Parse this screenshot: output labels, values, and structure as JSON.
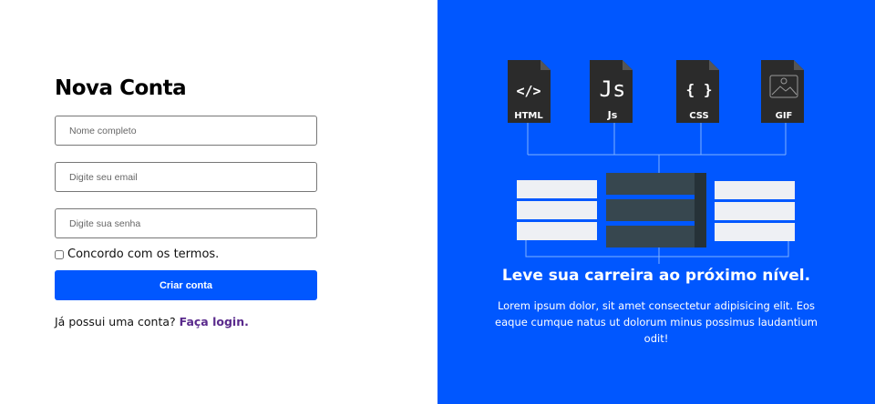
{
  "form": {
    "title": "Nova Conta",
    "name_placeholder": "Nome completo",
    "email_placeholder": "Digite seu email",
    "password_placeholder": "Digite sua senha",
    "terms_label": "Concordo com os termos.",
    "submit_label": "Criar conta",
    "login_prompt": "Já possui uma conta?",
    "login_link": "Faça login."
  },
  "hero": {
    "files": [
      {
        "glyph": "</>",
        "label": "HTML"
      },
      {
        "glyph": "Js",
        "label": "Js"
      },
      {
        "glyph": "{ }",
        "label": "CSS"
      },
      {
        "glyph": "image-icon",
        "label": "GIF"
      }
    ],
    "headline": "Leve sua carreira ao próximo nível.",
    "description": "Lorem ipsum dolor, sit amet consectetur adipisicing elit. Eos eaque cumque natus ut dolorum minus possimus laudantium odit!"
  },
  "colors": {
    "brand": "#0057ff",
    "link": "#5a2a8c"
  }
}
